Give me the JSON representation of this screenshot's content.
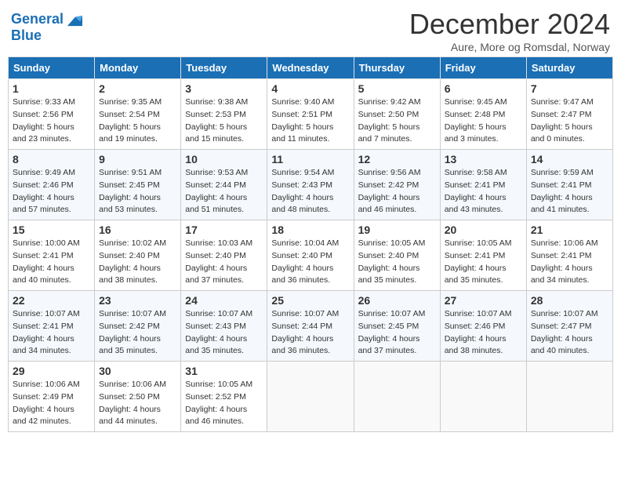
{
  "header": {
    "logo_line1": "General",
    "logo_line2": "Blue",
    "month": "December 2024",
    "location": "Aure, More og Romsdal, Norway"
  },
  "days_of_week": [
    "Sunday",
    "Monday",
    "Tuesday",
    "Wednesday",
    "Thursday",
    "Friday",
    "Saturday"
  ],
  "weeks": [
    [
      {
        "day": 1,
        "sunrise": "9:33 AM",
        "sunset": "2:56 PM",
        "daylight": "5 hours and 23 minutes."
      },
      {
        "day": 2,
        "sunrise": "9:35 AM",
        "sunset": "2:54 PM",
        "daylight": "5 hours and 19 minutes."
      },
      {
        "day": 3,
        "sunrise": "9:38 AM",
        "sunset": "2:53 PM",
        "daylight": "5 hours and 15 minutes."
      },
      {
        "day": 4,
        "sunrise": "9:40 AM",
        "sunset": "2:51 PM",
        "daylight": "5 hours and 11 minutes."
      },
      {
        "day": 5,
        "sunrise": "9:42 AM",
        "sunset": "2:50 PM",
        "daylight": "5 hours and 7 minutes."
      },
      {
        "day": 6,
        "sunrise": "9:45 AM",
        "sunset": "2:48 PM",
        "daylight": "5 hours and 3 minutes."
      },
      {
        "day": 7,
        "sunrise": "9:47 AM",
        "sunset": "2:47 PM",
        "daylight": "5 hours and 0 minutes."
      }
    ],
    [
      {
        "day": 8,
        "sunrise": "9:49 AM",
        "sunset": "2:46 PM",
        "daylight": "4 hours and 57 minutes."
      },
      {
        "day": 9,
        "sunrise": "9:51 AM",
        "sunset": "2:45 PM",
        "daylight": "4 hours and 53 minutes."
      },
      {
        "day": 10,
        "sunrise": "9:53 AM",
        "sunset": "2:44 PM",
        "daylight": "4 hours and 51 minutes."
      },
      {
        "day": 11,
        "sunrise": "9:54 AM",
        "sunset": "2:43 PM",
        "daylight": "4 hours and 48 minutes."
      },
      {
        "day": 12,
        "sunrise": "9:56 AM",
        "sunset": "2:42 PM",
        "daylight": "4 hours and 46 minutes."
      },
      {
        "day": 13,
        "sunrise": "9:58 AM",
        "sunset": "2:41 PM",
        "daylight": "4 hours and 43 minutes."
      },
      {
        "day": 14,
        "sunrise": "9:59 AM",
        "sunset": "2:41 PM",
        "daylight": "4 hours and 41 minutes."
      }
    ],
    [
      {
        "day": 15,
        "sunrise": "10:00 AM",
        "sunset": "2:41 PM",
        "daylight": "4 hours and 40 minutes."
      },
      {
        "day": 16,
        "sunrise": "10:02 AM",
        "sunset": "2:40 PM",
        "daylight": "4 hours and 38 minutes."
      },
      {
        "day": 17,
        "sunrise": "10:03 AM",
        "sunset": "2:40 PM",
        "daylight": "4 hours and 37 minutes."
      },
      {
        "day": 18,
        "sunrise": "10:04 AM",
        "sunset": "2:40 PM",
        "daylight": "4 hours and 36 minutes."
      },
      {
        "day": 19,
        "sunrise": "10:05 AM",
        "sunset": "2:40 PM",
        "daylight": "4 hours and 35 minutes."
      },
      {
        "day": 20,
        "sunrise": "10:05 AM",
        "sunset": "2:41 PM",
        "daylight": "4 hours and 35 minutes."
      },
      {
        "day": 21,
        "sunrise": "10:06 AM",
        "sunset": "2:41 PM",
        "daylight": "4 hours and 34 minutes."
      }
    ],
    [
      {
        "day": 22,
        "sunrise": "10:07 AM",
        "sunset": "2:41 PM",
        "daylight": "4 hours and 34 minutes."
      },
      {
        "day": 23,
        "sunrise": "10:07 AM",
        "sunset": "2:42 PM",
        "daylight": "4 hours and 35 minutes."
      },
      {
        "day": 24,
        "sunrise": "10:07 AM",
        "sunset": "2:43 PM",
        "daylight": "4 hours and 35 minutes."
      },
      {
        "day": 25,
        "sunrise": "10:07 AM",
        "sunset": "2:44 PM",
        "daylight": "4 hours and 36 minutes."
      },
      {
        "day": 26,
        "sunrise": "10:07 AM",
        "sunset": "2:45 PM",
        "daylight": "4 hours and 37 minutes."
      },
      {
        "day": 27,
        "sunrise": "10:07 AM",
        "sunset": "2:46 PM",
        "daylight": "4 hours and 38 minutes."
      },
      {
        "day": 28,
        "sunrise": "10:07 AM",
        "sunset": "2:47 PM",
        "daylight": "4 hours and 40 minutes."
      }
    ],
    [
      {
        "day": 29,
        "sunrise": "10:06 AM",
        "sunset": "2:49 PM",
        "daylight": "4 hours and 42 minutes."
      },
      {
        "day": 30,
        "sunrise": "10:06 AM",
        "sunset": "2:50 PM",
        "daylight": "4 hours and 44 minutes."
      },
      {
        "day": 31,
        "sunrise": "10:05 AM",
        "sunset": "2:52 PM",
        "daylight": "4 hours and 46 minutes."
      },
      null,
      null,
      null,
      null
    ]
  ],
  "labels": {
    "sunrise": "Sunrise:",
    "sunset": "Sunset:",
    "daylight": "Daylight:"
  }
}
